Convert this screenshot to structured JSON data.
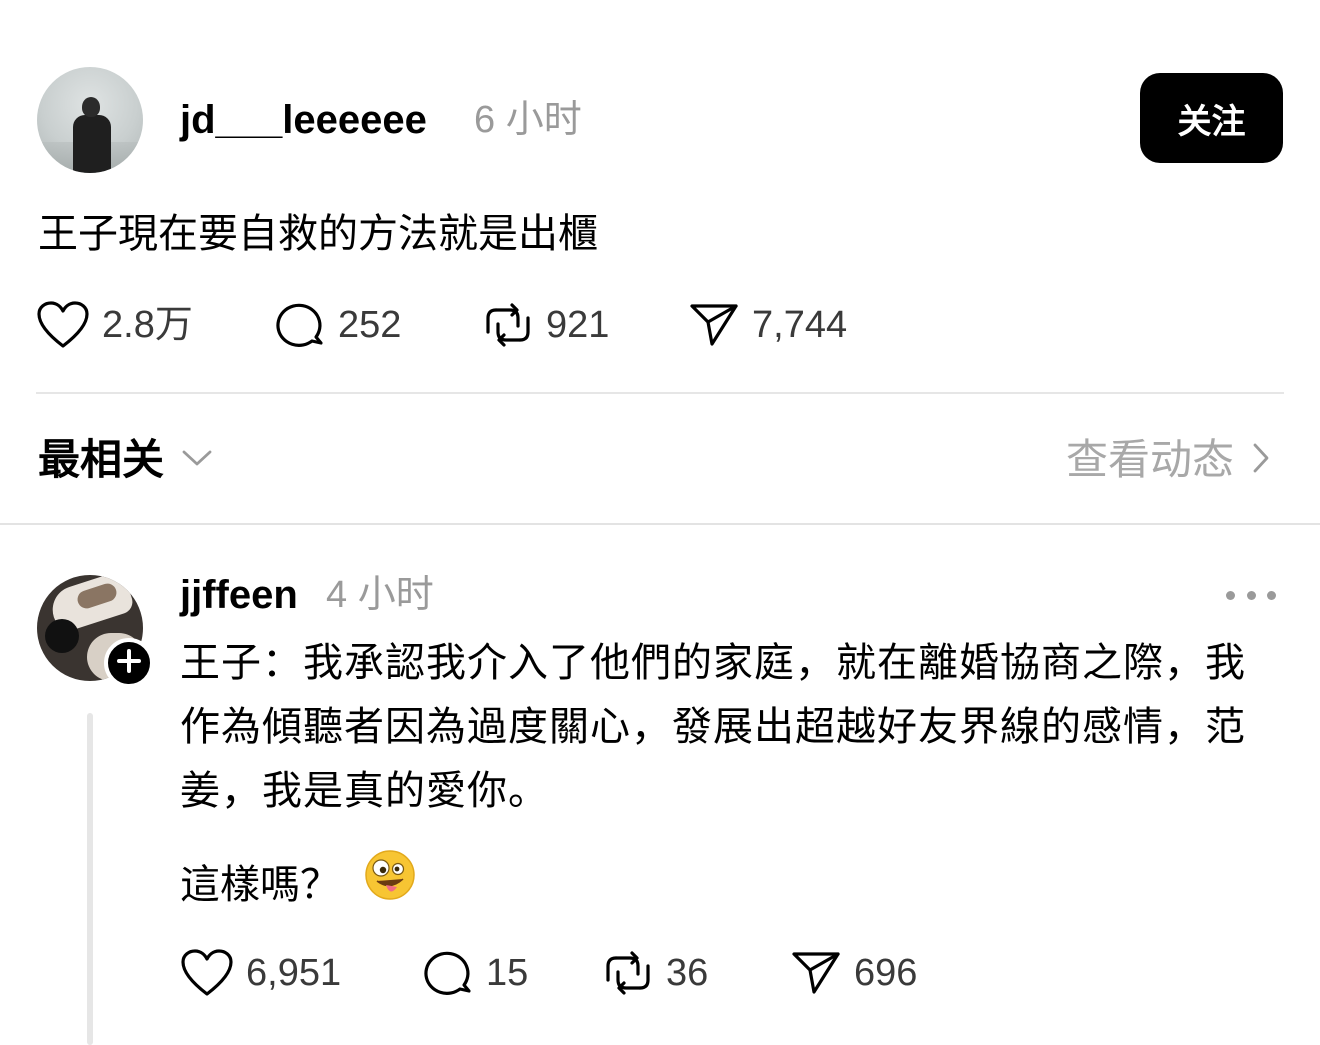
{
  "post": {
    "username": "jd___leeeeee",
    "timestamp": "6 小时",
    "follow_label": "关注",
    "text": "王子現在要自救的方法就是出櫃",
    "actions": {
      "likes": "2.8万",
      "comments": "252",
      "reposts": "921",
      "shares": "7,744"
    }
  },
  "sort": {
    "label": "最相关",
    "view_activity": "查看动态"
  },
  "reply": {
    "username": "jjffeen",
    "timestamp": "4 小时",
    "text": "王子：我承認我介入了他們的家庭，就在離婚協商之際，我作為傾聽者因為過度關心，發展出超越好友界線的感情，范姜，我是真的愛你。",
    "text2": "這樣嗎？",
    "emoji": "zany-face",
    "actions": {
      "likes": "6,951",
      "comments": "15",
      "reposts": "36",
      "shares": "696"
    }
  },
  "colors": {
    "primary": "#000000",
    "muted": "#9a9a9a",
    "divider": "#e6e6e6",
    "button_bg": "#000000",
    "button_text": "#ffffff"
  }
}
